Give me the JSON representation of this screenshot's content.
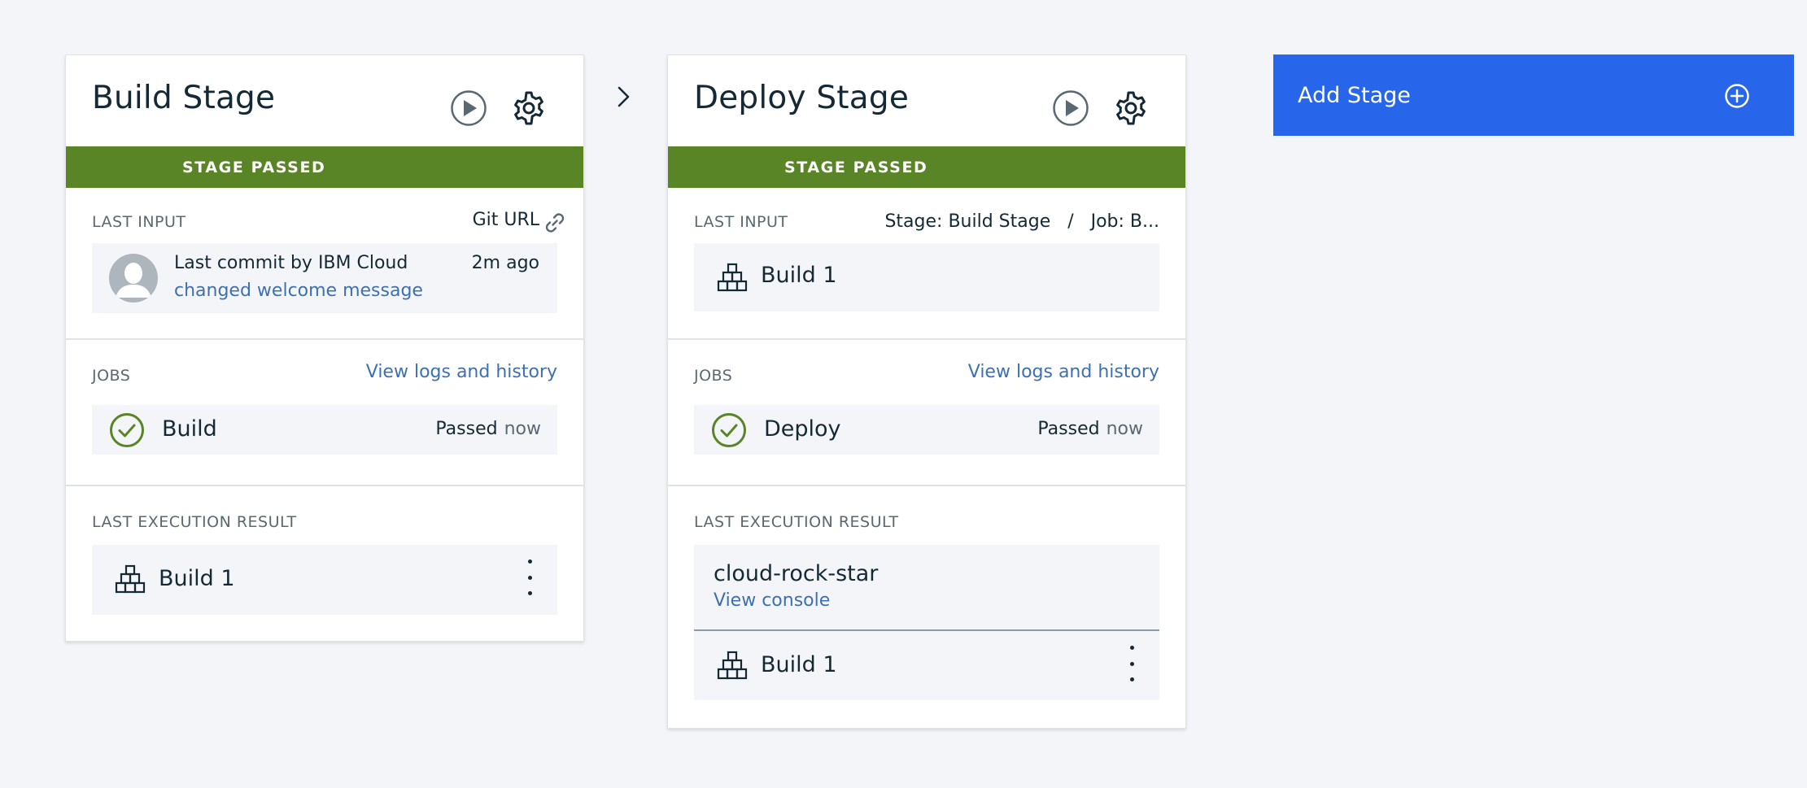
{
  "stages": {
    "build": {
      "title": "Build Stage",
      "status": "STAGE PASSED",
      "last_input": {
        "label": "LAST INPUT",
        "source": "Git URL",
        "commit_author": "Last commit by IBM Cloud",
        "commit_message": "changed welcome message",
        "commit_time": "2m ago"
      },
      "jobs": {
        "label": "JOBS",
        "link": "View logs and history",
        "job_name": "Build",
        "job_status": "Passed",
        "job_time": "now"
      },
      "last_result": {
        "label": "LAST EXECUTION RESULT",
        "build": "Build 1"
      }
    },
    "deploy": {
      "title": "Deploy Stage",
      "status": "STAGE PASSED",
      "last_input": {
        "label": "LAST INPUT",
        "source": "Stage: Build Stage   /   Job: B...",
        "build": "Build 1"
      },
      "jobs": {
        "label": "JOBS",
        "link": "View logs and history",
        "job_name": "Deploy",
        "job_status": "Passed",
        "job_time": "now"
      },
      "last_result": {
        "label": "LAST EXECUTION RESULT",
        "app_name": "cloud-rock-star",
        "console_link": "View console",
        "build": "Build 1"
      }
    }
  },
  "add_stage": {
    "label": "Add Stage"
  },
  "colors": {
    "background": "#f4f5f9",
    "passed": "#5a8526",
    "link": "#3d70b2",
    "accent": "#2766ea"
  },
  "icons": [
    "play-icon",
    "gear-icon",
    "link-icon",
    "avatar-icon",
    "check-circle-icon",
    "build-blocks-icon",
    "overflow-menu-icon",
    "chevron-right-icon",
    "add-circle-icon"
  ]
}
